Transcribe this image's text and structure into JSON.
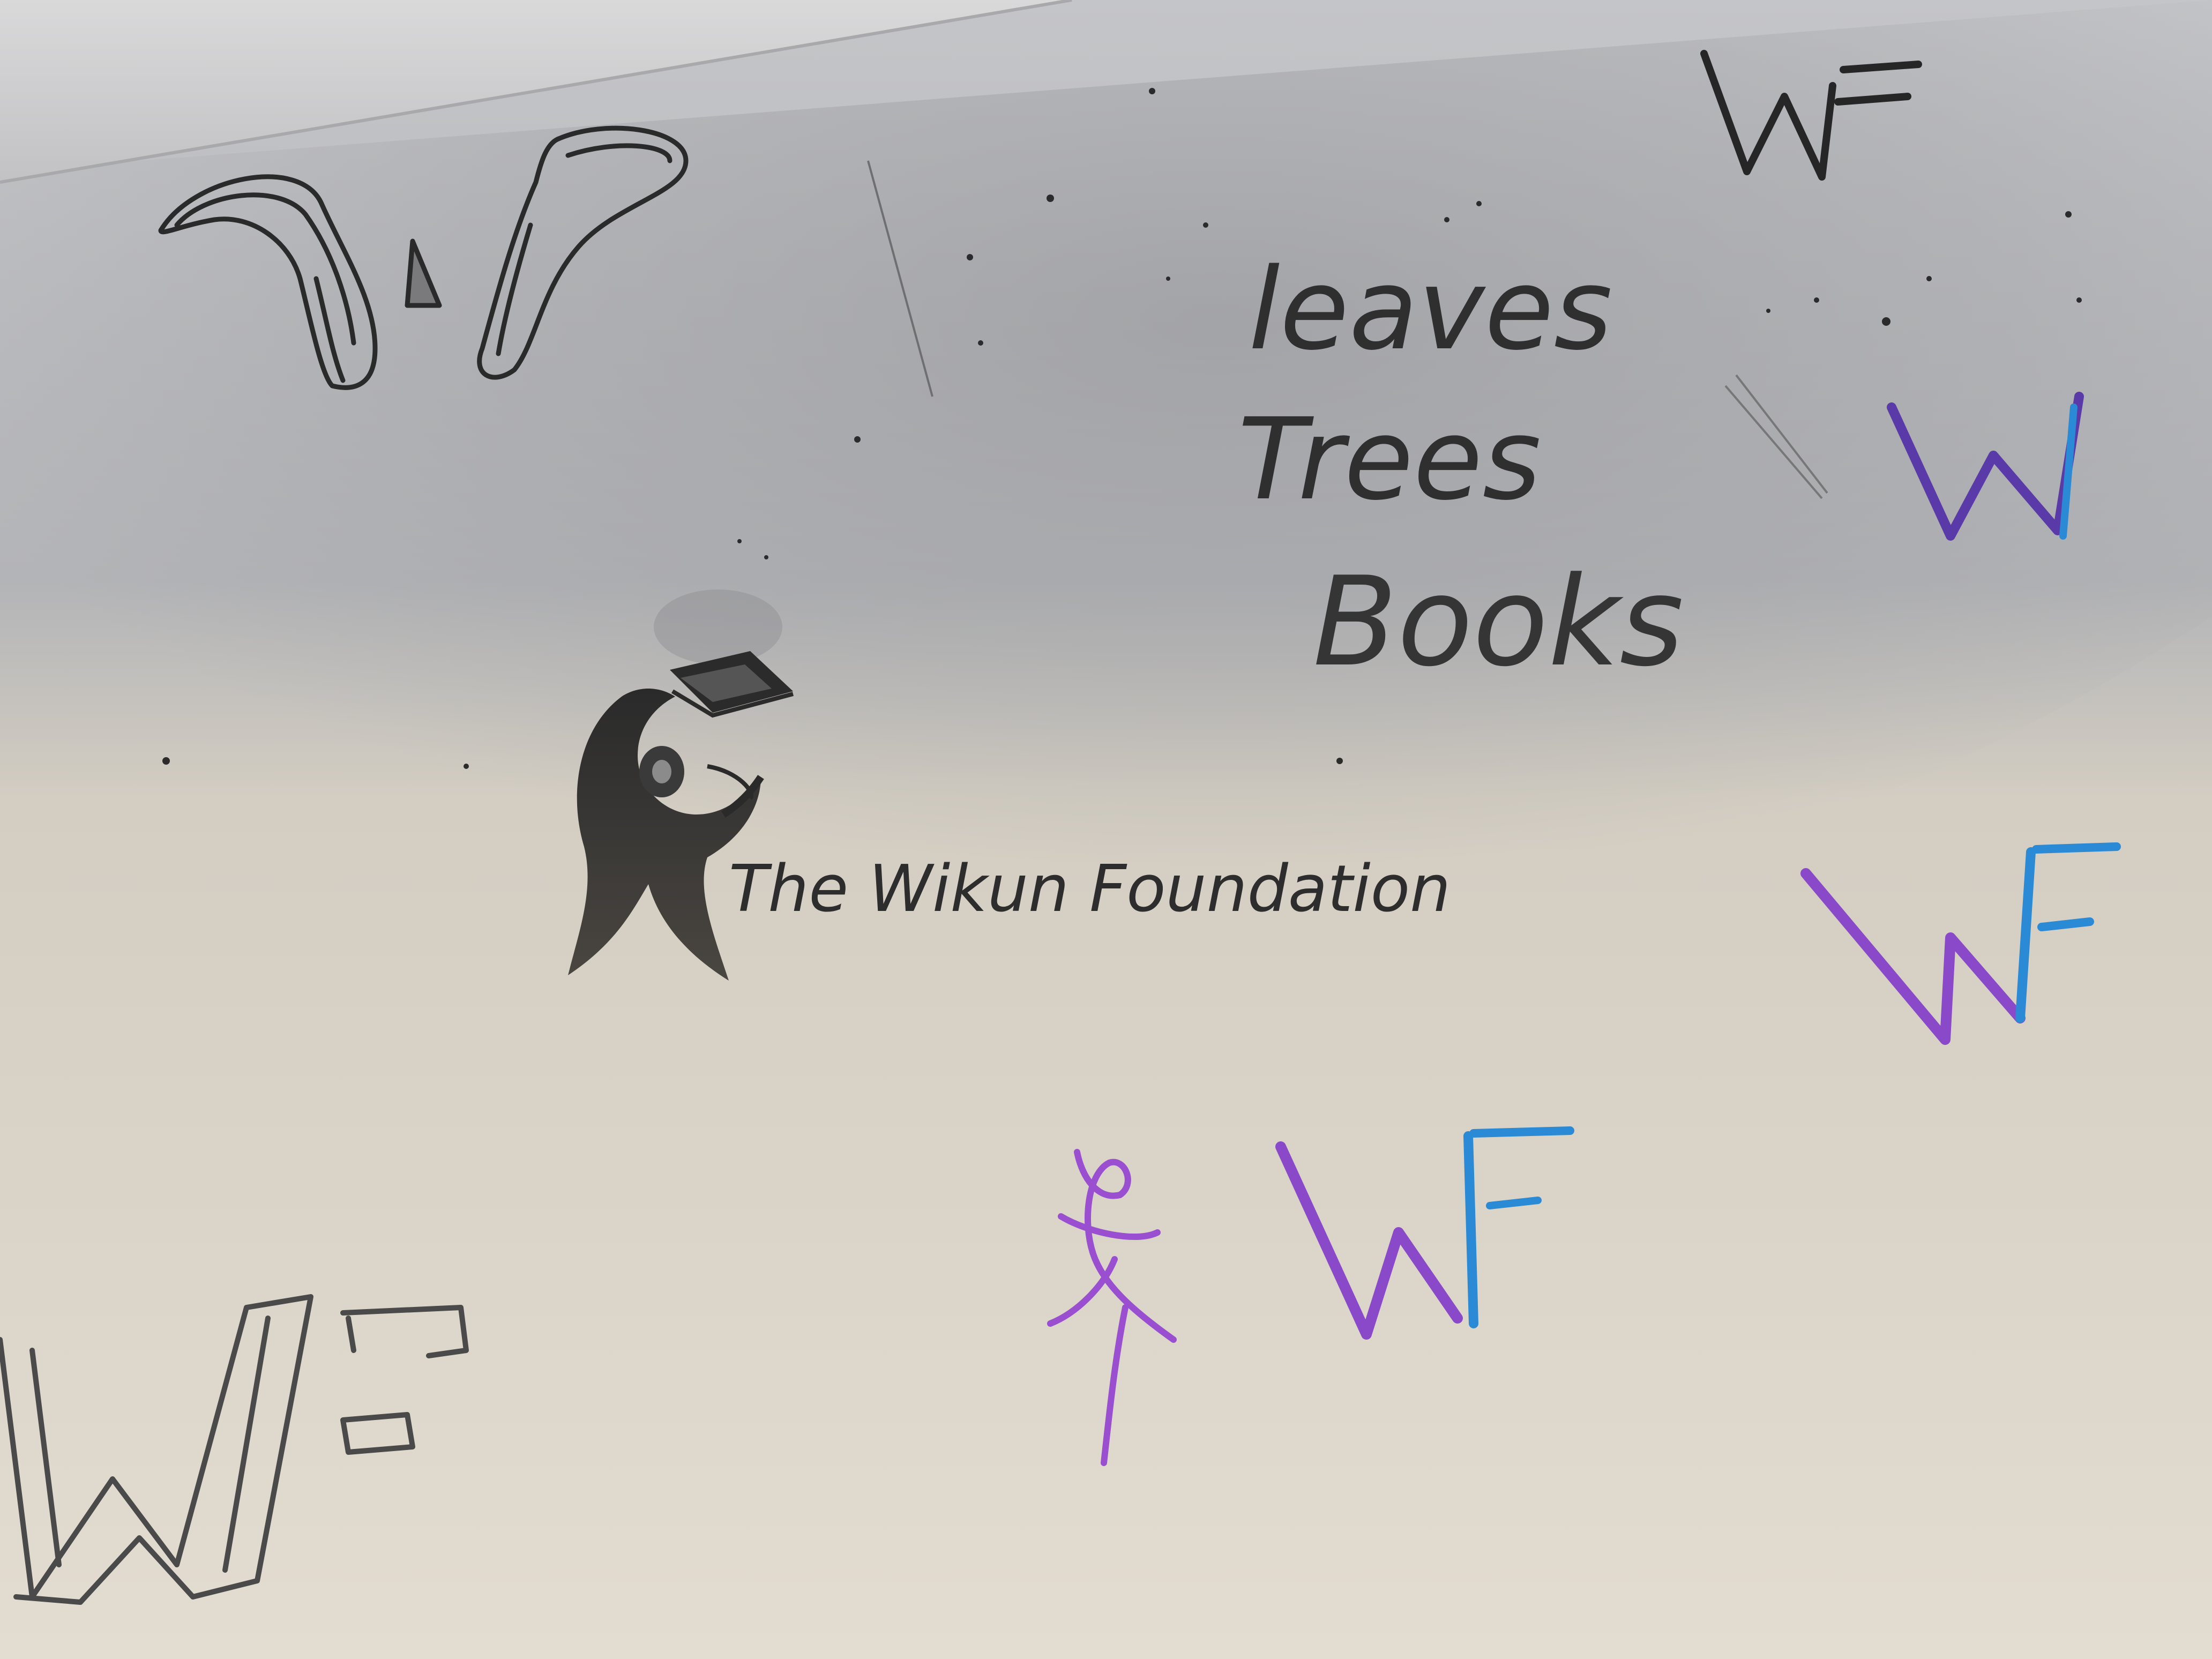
{
  "scene": {
    "description_colors": {
      "wall_lit": "#e4ddd1",
      "wall_mid": "#cfc8bb",
      "shadow": "#9fa0a3",
      "ceiling_edge": "#c9c9cb",
      "pencil": "#2d2d2d",
      "purple": "#7b3fb6",
      "blue": "#2a8ad6",
      "violet": "#8a49c9"
    },
    "words": {
      "leaves": "leaves",
      "trees": "Trees",
      "books": "Books",
      "foundation": "The Wikun Foundation"
    },
    "monograms": {
      "wf_letters_w": "W",
      "wf_letters_f": "F",
      "ampersand": "&"
    },
    "icons": [
      "quote-mark-drawing-icon",
      "graduate-figure-logo-icon",
      "wf-monogram-icon"
    ]
  }
}
